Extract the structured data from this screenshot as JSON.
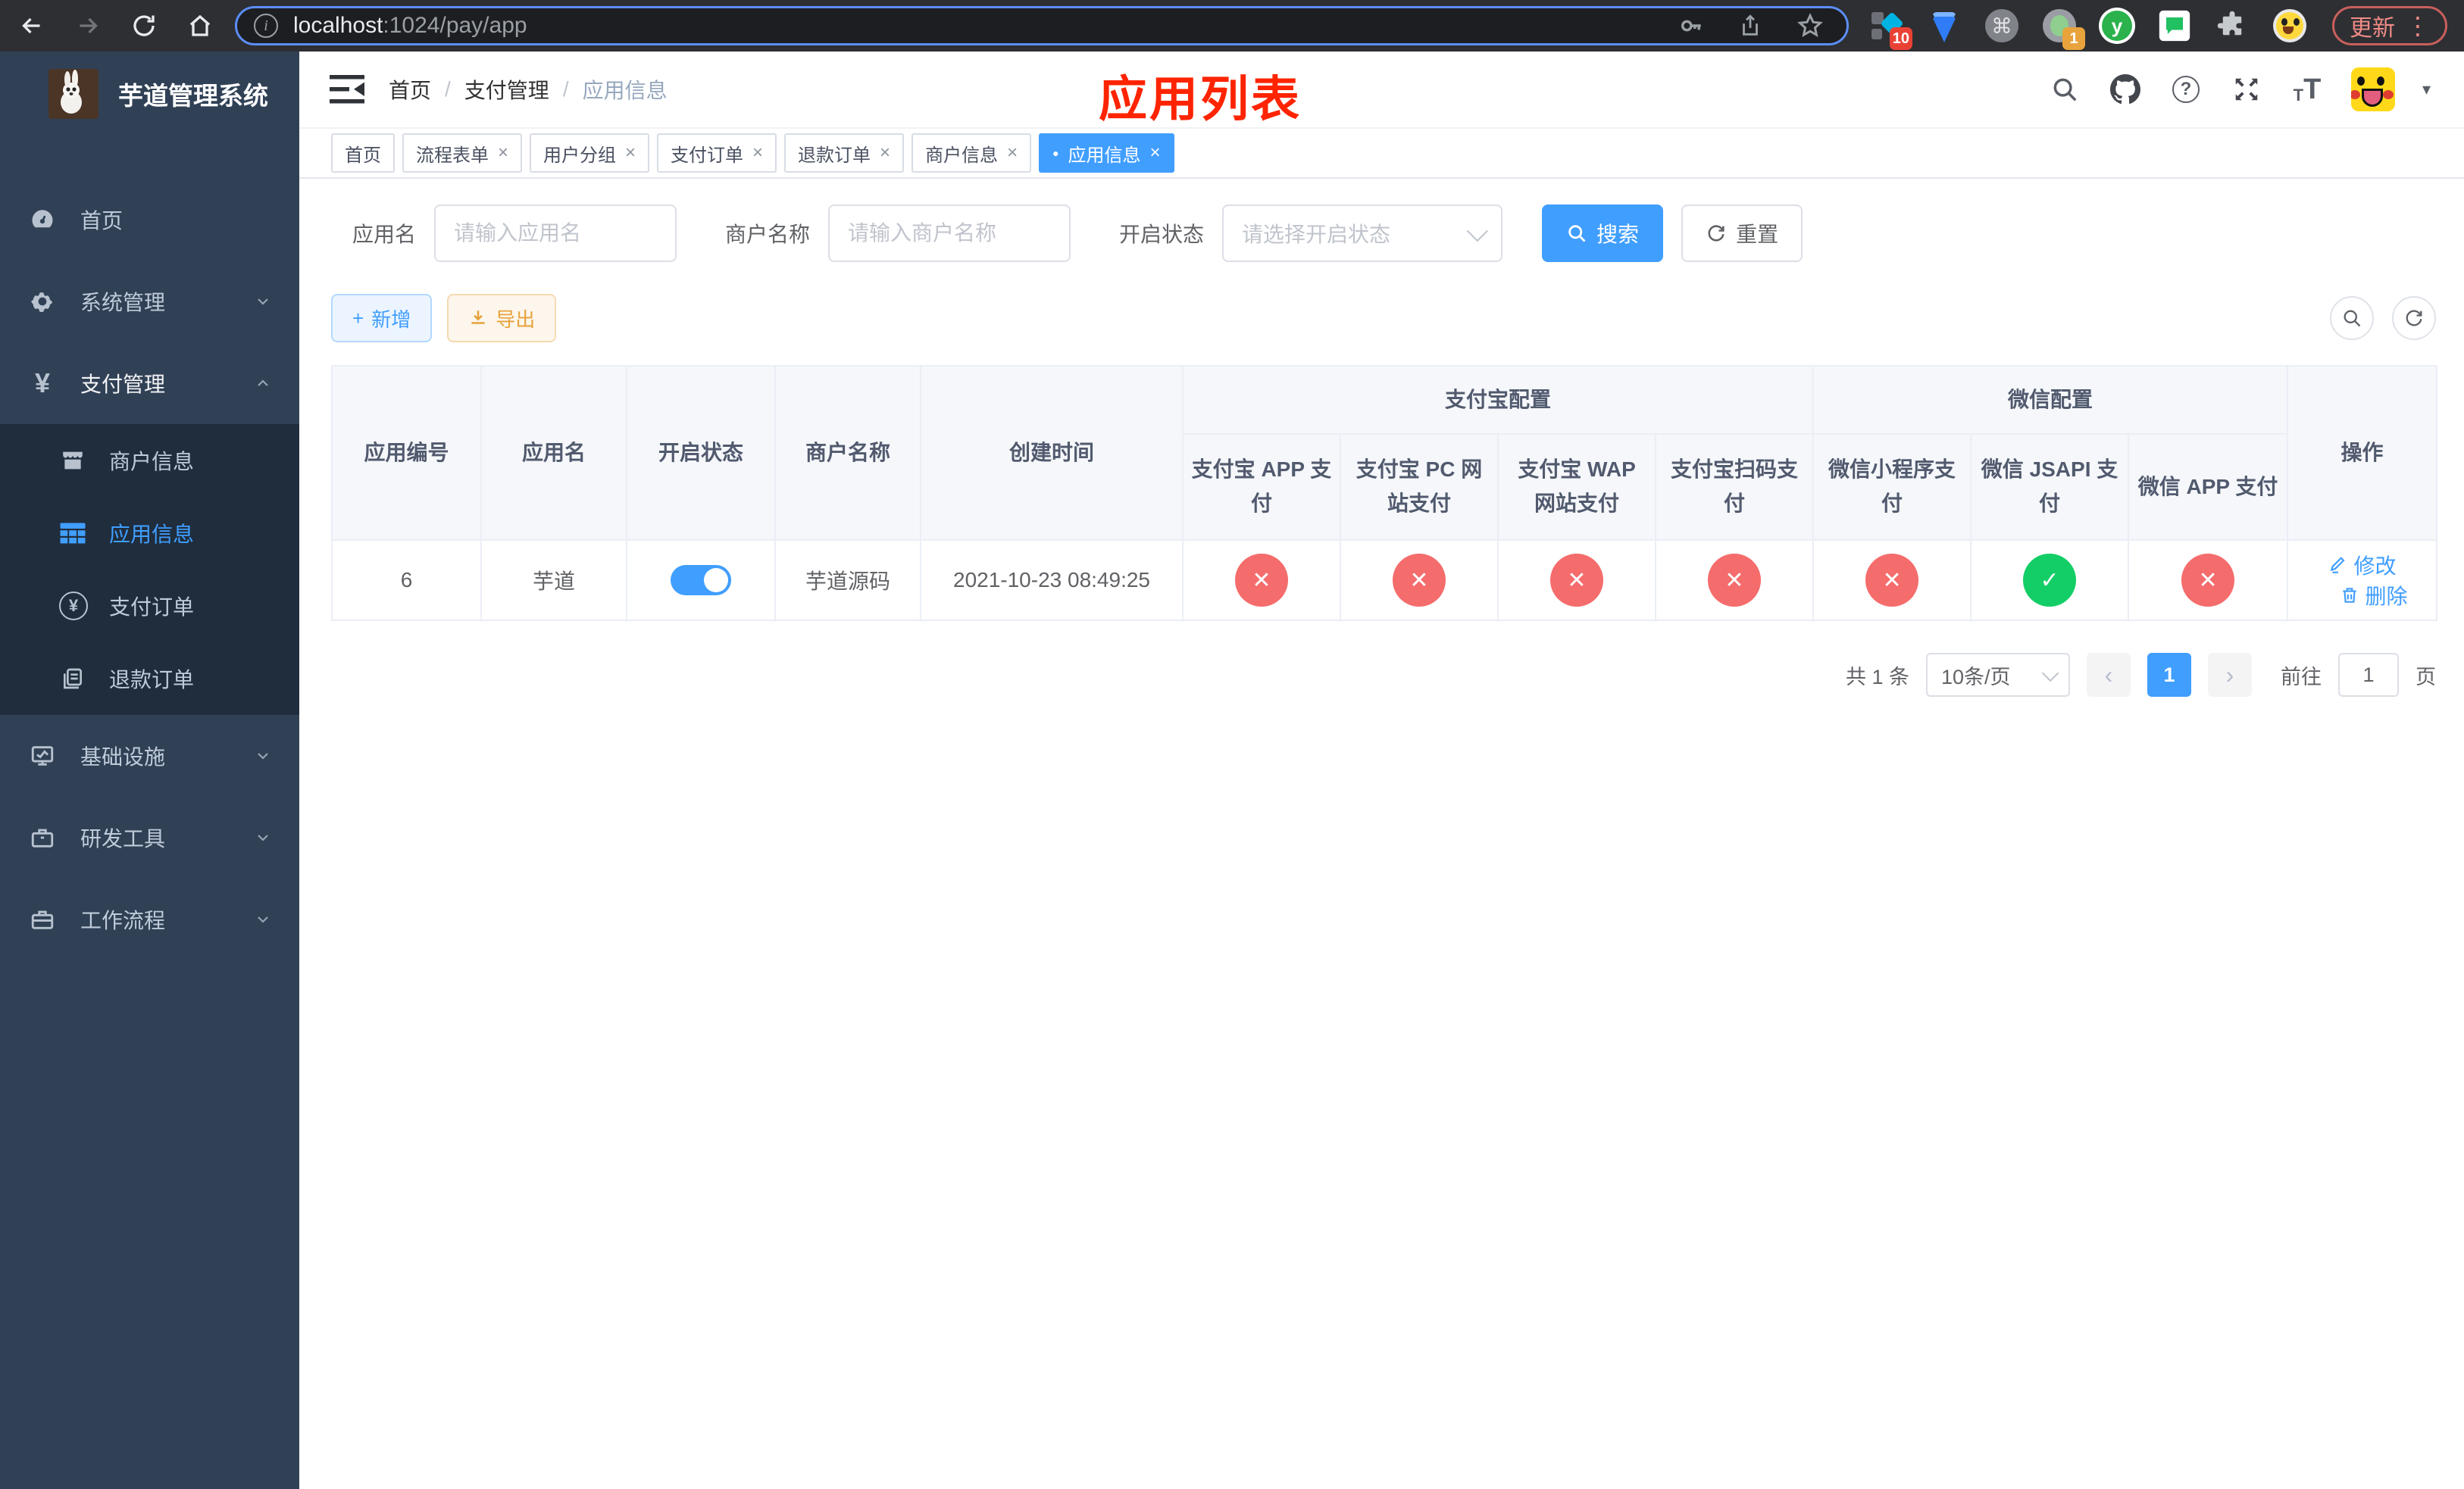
{
  "glyphs": {
    "info": "i",
    "command": "⌘",
    "yuque": "y",
    "kebab": "⋮",
    "breadcrumb_sep": "/",
    "tag_close": "×",
    "tag_dot": "●",
    "check": "✓",
    "cross": "✕",
    "yen": "¥",
    "prev": "‹",
    "next": "›",
    "caret": "▾",
    "plus": "+",
    "help": "?",
    "font_small": "T",
    "font_big": "T"
  },
  "browser": {
    "url_host": "localhost",
    "url_rest": ":1024/pay/app",
    "ext1_badge": "10",
    "ext4_badge": "1",
    "update_label": "更新"
  },
  "sidebar": {
    "title": "芋道管理系统",
    "items": [
      {
        "label": "首页"
      },
      {
        "label": "系统管理"
      },
      {
        "label": "支付管理"
      },
      {
        "label": "商户信息"
      },
      {
        "label": "应用信息"
      },
      {
        "label": "支付订单"
      },
      {
        "label": "退款订单"
      },
      {
        "label": "基础设施"
      },
      {
        "label": "研发工具"
      },
      {
        "label": "工作流程"
      }
    ]
  },
  "header": {
    "breadcrumb": [
      "首页",
      "支付管理",
      "应用信息"
    ],
    "annotation": "应用列表"
  },
  "tags": [
    {
      "label": "首页",
      "closable": false,
      "active": false
    },
    {
      "label": "流程表单",
      "closable": true,
      "active": false
    },
    {
      "label": "用户分组",
      "closable": true,
      "active": false
    },
    {
      "label": "支付订单",
      "closable": true,
      "active": false
    },
    {
      "label": "退款订单",
      "closable": true,
      "active": false
    },
    {
      "label": "商户信息",
      "closable": true,
      "active": false
    },
    {
      "label": "应用信息",
      "closable": true,
      "active": true
    }
  ],
  "filters": {
    "app_name_label": "应用名",
    "app_name_placeholder": "请输入应用名",
    "merchant_label": "商户名称",
    "merchant_placeholder": "请输入商户名称",
    "status_label": "开启状态",
    "status_placeholder": "请选择开启状态",
    "search_label": "搜索",
    "reset_label": "重置"
  },
  "toolbar": {
    "add_label": "新增",
    "export_label": "导出"
  },
  "table": {
    "columns": [
      "应用编号",
      "应用名",
      "开启状态",
      "商户名称",
      "创建时间"
    ],
    "group_alipay": "支付宝配置",
    "group_wechat": "微信配置",
    "pay_columns": [
      "支付宝 APP 支付",
      "支付宝 PC 网站支付",
      "支付宝 WAP 网站支付",
      "支付宝扫码支付",
      "微信小程序支付",
      "微信 JSAPI 支付",
      "微信 APP 支付"
    ],
    "actions_column": "操作",
    "actions": {
      "edit": "修改",
      "delete": "删除"
    },
    "rows": [
      {
        "id": "6",
        "name": "芋道",
        "enabled": true,
        "merchant": "芋道源码",
        "created": "2021-10-23 08:49:25",
        "pay_status": [
          false,
          false,
          false,
          false,
          false,
          true,
          false
        ]
      }
    ]
  },
  "pagination": {
    "total": "共 1 条",
    "page_size": "10条/页",
    "current_page": "1",
    "goto_label": "前往",
    "goto_value": "1",
    "page_suffix": "页"
  },
  "colors": {
    "accent": "#409eff",
    "sidebar_bg": "#304156",
    "submenu_bg": "#1f2d3d",
    "status_off": "#f56c6c",
    "status_on": "#13ce66",
    "annotation": "#fe2400"
  }
}
